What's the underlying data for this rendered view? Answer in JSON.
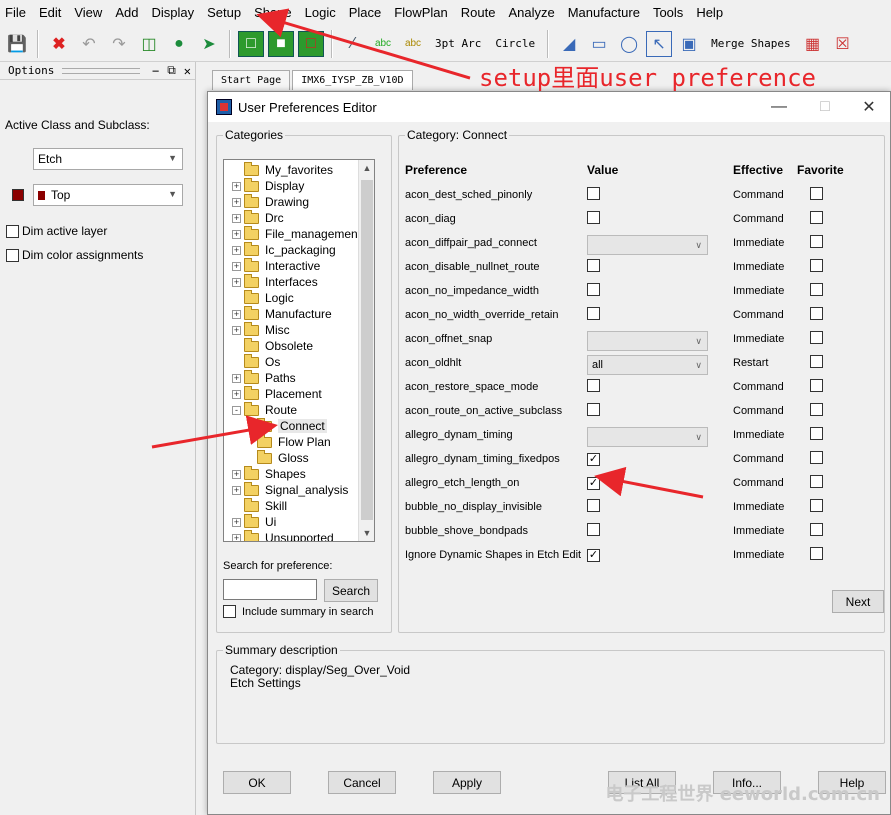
{
  "menubar": [
    "File",
    "Edit",
    "View",
    "Add",
    "Display",
    "Setup",
    "Shape",
    "Logic",
    "Place",
    "FlowPlan",
    "Route",
    "Analyze",
    "Manufacture",
    "Tools",
    "Help"
  ],
  "toolbar": {
    "text_3pt_arc": "3pt Arc",
    "text_circle": "Circle",
    "text_merge_shapes": "Merge Shapes"
  },
  "options_panel": {
    "title": "Options",
    "active_class_label": "Active Class and Subclass:",
    "class_value": "Etch",
    "subclass_value": "Top",
    "dim_active_layer": "Dim active layer",
    "dim_color_assignments": "Dim color assignments"
  },
  "tabs": [
    "Start Page",
    "IMX6_IYSP_ZB_V10D"
  ],
  "dialog": {
    "title": "User Preferences Editor",
    "categories_label": "Categories",
    "category_label": "Category:  Connect",
    "tree": [
      {
        "label": "My_favorites",
        "expander": ""
      },
      {
        "label": "Display",
        "expander": "+"
      },
      {
        "label": "Drawing",
        "expander": "+"
      },
      {
        "label": "Drc",
        "expander": "+"
      },
      {
        "label": "File_management",
        "expander": "+"
      },
      {
        "label": "Ic_packaging",
        "expander": "+"
      },
      {
        "label": "Interactive",
        "expander": "+"
      },
      {
        "label": "Interfaces",
        "expander": "+"
      },
      {
        "label": "Logic",
        "expander": ""
      },
      {
        "label": "Manufacture",
        "expander": "+"
      },
      {
        "label": "Misc",
        "expander": "+"
      },
      {
        "label": "Obsolete",
        "expander": ""
      },
      {
        "label": "Os",
        "expander": ""
      },
      {
        "label": "Paths",
        "expander": "+"
      },
      {
        "label": "Placement",
        "expander": "+"
      },
      {
        "label": "Route",
        "expander": "-"
      },
      {
        "label": "Connect",
        "expander": "child",
        "selected": true
      },
      {
        "label": "Flow Plan",
        "expander": "child"
      },
      {
        "label": "Gloss",
        "expander": "child"
      },
      {
        "label": "Shapes",
        "expander": "+"
      },
      {
        "label": "Signal_analysis",
        "expander": "+"
      },
      {
        "label": "Skill",
        "expander": ""
      },
      {
        "label": "Ui",
        "expander": "+"
      },
      {
        "label": "Unsupported",
        "expander": "+"
      }
    ],
    "search_label": "Search for preference:",
    "search_button": "Search",
    "include_summary": "Include summary in search",
    "headers": {
      "pref": "Preference",
      "value": "Value",
      "effective": "Effective",
      "favorite": "Favorite"
    },
    "prefs": [
      {
        "name": "acon_dest_sched_pinonly",
        "type": "check",
        "checked": false,
        "effective": "Command"
      },
      {
        "name": "acon_diag",
        "type": "check",
        "checked": false,
        "effective": "Command"
      },
      {
        "name": "acon_diffpair_pad_connect",
        "type": "combo",
        "value": "",
        "effective": "Immediate"
      },
      {
        "name": "acon_disable_nullnet_route",
        "type": "check",
        "checked": false,
        "effective": "Immediate"
      },
      {
        "name": "acon_no_impedance_width",
        "type": "check",
        "checked": false,
        "effective": "Immediate"
      },
      {
        "name": "acon_no_width_override_retain",
        "type": "check",
        "checked": false,
        "effective": "Command"
      },
      {
        "name": "acon_offnet_snap",
        "type": "combo",
        "value": "",
        "effective": "Immediate"
      },
      {
        "name": "acon_oldhlt",
        "type": "combo",
        "value": "all",
        "effective": "Restart"
      },
      {
        "name": "acon_restore_space_mode",
        "type": "check",
        "checked": false,
        "effective": "Command"
      },
      {
        "name": "acon_route_on_active_subclass",
        "type": "check",
        "checked": false,
        "effective": "Command"
      },
      {
        "name": "allegro_dynam_timing",
        "type": "combo",
        "value": "",
        "effective": "Immediate"
      },
      {
        "name": "allegro_dynam_timing_fixedpos",
        "type": "check",
        "checked": true,
        "effective": "Command"
      },
      {
        "name": "allegro_etch_length_on",
        "type": "check",
        "checked": true,
        "effective": "Command"
      },
      {
        "name": "bubble_no_display_invisible",
        "type": "check",
        "checked": false,
        "effective": "Immediate"
      },
      {
        "name": "bubble_shove_bondpads",
        "type": "check",
        "checked": false,
        "effective": "Immediate"
      },
      {
        "name": "Ignore Dynamic Shapes in Etch Edit",
        "type": "check",
        "checked": true,
        "effective": "Immediate"
      }
    ],
    "next_button": "Next",
    "summary_label": "Summary description",
    "summary_line1": "Category: display/Seg_Over_Void",
    "summary_line2": "Etch Settings",
    "buttons": {
      "ok": "OK",
      "cancel": "Cancel",
      "apply": "Apply",
      "list_all": "List All",
      "info": "Info...",
      "help": "Help"
    }
  },
  "annotation": "setup里面user preference",
  "watermark": "电子工程世界 eeworld.com.cn",
  "colors": {
    "annotation_red": "#e8262b",
    "subclass_swatch": "#8b0000"
  }
}
